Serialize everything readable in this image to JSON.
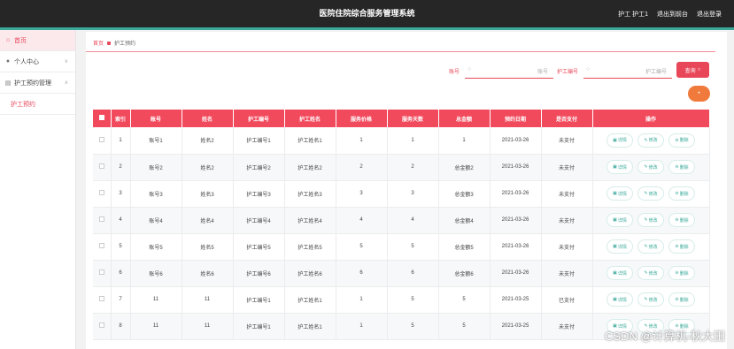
{
  "app": {
    "title": "医院住院综合服务管理系统",
    "header_links": [
      "护工 护工1",
      "退出到前台",
      "退出登录"
    ]
  },
  "sidebar": {
    "home": "首页",
    "personal": "个人中心",
    "booking_mgmt": "护工预约管理",
    "booking_sub": "护工预约"
  },
  "breadcrumb": {
    "home": "首页",
    "current": "护工预约"
  },
  "search": {
    "account_label": "账号",
    "account_placeholder": "账号",
    "caregiver_label": "护工编号",
    "caregiver_placeholder": "护工编号",
    "query_label": "查询",
    "add_label": "+"
  },
  "table": {
    "headers": [
      "索引",
      "账号",
      "姓名",
      "护工编号",
      "护工姓名",
      "服务价格",
      "服务天数",
      "总金额",
      "预约日期",
      "是否支付",
      "操作"
    ],
    "actions": [
      "详情",
      "修改",
      "删除"
    ],
    "rows": [
      [
        "1",
        "账号1",
        "姓名2",
        "护工编号1",
        "护工姓名1",
        "1",
        "1",
        "1",
        "2021-03-26",
        "未支付"
      ],
      [
        "2",
        "账号2",
        "姓名2",
        "护工编号2",
        "护工姓名2",
        "2",
        "2",
        "总金额2",
        "2021-03-26",
        "未支付"
      ],
      [
        "3",
        "账号3",
        "姓名3",
        "护工编号3",
        "护工姓名3",
        "3",
        "3",
        "总金额3",
        "2021-03-26",
        "未支付"
      ],
      [
        "4",
        "账号4",
        "姓名4",
        "护工编号4",
        "护工姓名4",
        "4",
        "4",
        "总金额4",
        "2021-03-26",
        "未支付"
      ],
      [
        "5",
        "账号5",
        "姓名5",
        "护工编号5",
        "护工姓名5",
        "5",
        "5",
        "总金额5",
        "2021-03-26",
        "未支付"
      ],
      [
        "6",
        "账号6",
        "姓名6",
        "护工编号6",
        "护工姓名6",
        "6",
        "6",
        "总金额6",
        "2021-03-26",
        "未支付"
      ],
      [
        "7",
        "11",
        "11",
        "护工编号1",
        "护工姓名1",
        "1",
        "5",
        "5",
        "2021-03-25",
        "已支付"
      ],
      [
        "8",
        "11",
        "11",
        "护工编号1",
        "护工姓名1",
        "1",
        "5",
        "5",
        "2021-03-25",
        "未支付"
      ]
    ]
  },
  "watermark": "CSDN @计算机-秋大田",
  "colors": {
    "primary": "#e8475a",
    "header_bg": "#262626",
    "accent": "#3aa99a",
    "add_button": "#f07a3c"
  }
}
